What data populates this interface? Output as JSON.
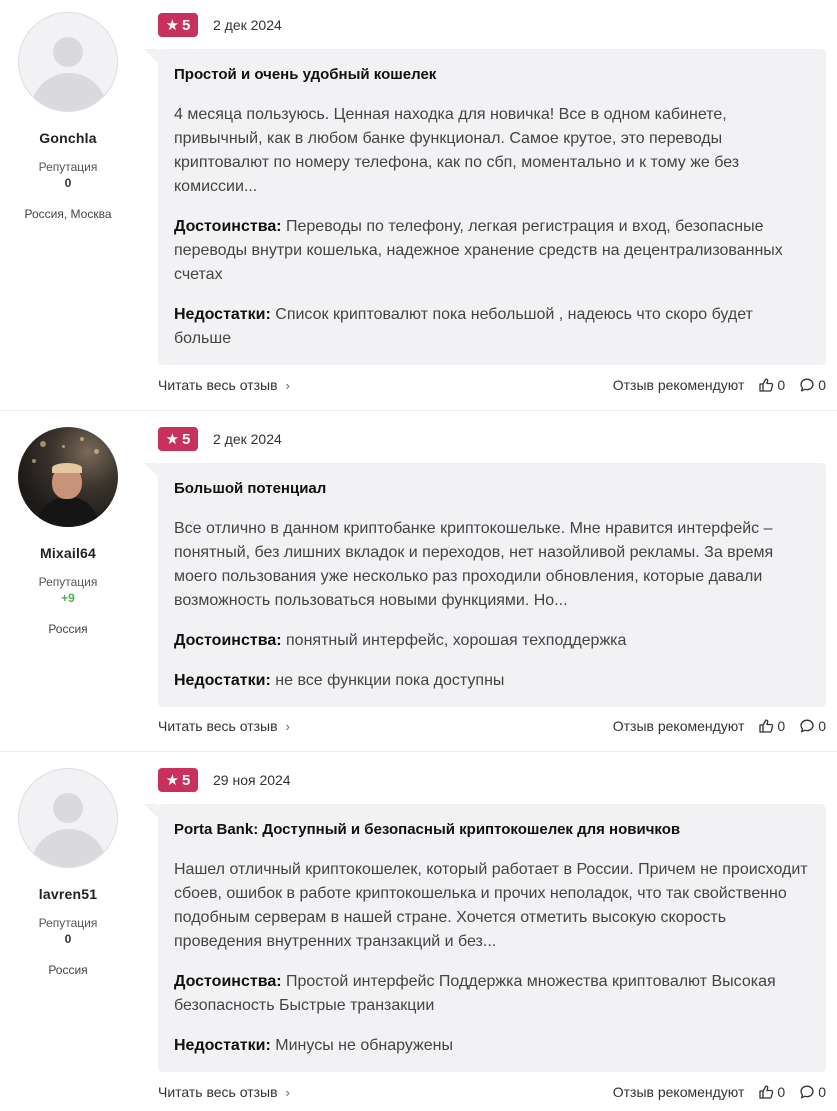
{
  "colors": {
    "rating_badge": "#c8325a",
    "bubble_bg": "#f2f2f4",
    "positive": "#4caf50"
  },
  "labels": {
    "reputation": "Репутация",
    "pros": "Достоинства:",
    "cons": "Недостатки:",
    "read_full": "Читать весь отзыв",
    "recommend": "Отзыв рекомендуют",
    "chevron": "›",
    "star": "★"
  },
  "reviews": [
    {
      "author": {
        "name": "Gonchla",
        "reputation": "0",
        "location": "Россия, Москва",
        "avatar": "placeholder-avatar-icon"
      },
      "rating": "5",
      "date": "2 дек 2024",
      "title": "Простой и очень удобный кошелек",
      "text": "4 месяца пользуюсь. Ценная находка для новичка! Все в одном кабинете, привычный, как в любом банке функционал. Самое крутое, это переводы криптовалют по номеру телефона, как по сбп, моментально и к тому же без комиссии...",
      "pros": "Переводы по телефону, легкая регистрация и вход, безопасные переводы внутри кошелька, надежное хранение средств на децентрализованных счетах",
      "cons": "Список криптовалют пока небольшой , надеюсь что скоро будет больше",
      "likes": "0",
      "comments": "0"
    },
    {
      "author": {
        "name": "Mixail64",
        "reputation": "+9",
        "location": "Россия",
        "avatar": "user-photo"
      },
      "rating": "5",
      "date": "2 дек 2024",
      "title": "Большой потенциал",
      "text": "Все отлично в данном криптобанке криптокошельке. Мне нравится интерфейс – понятный, без лишних вкладок и переходов, нет назойливой рекламы. За время моего пользования уже несколько раз проходили обновления, которые давали возможность пользоваться новыми функциями. Но...",
      "pros": "понятный интерфейс, хорошая техподдержка",
      "cons": "не все функции пока доступны",
      "likes": "0",
      "comments": "0"
    },
    {
      "author": {
        "name": "lavren51",
        "reputation": "0",
        "location": "Россия",
        "avatar": "placeholder-avatar-icon"
      },
      "rating": "5",
      "date": "29 ноя 2024",
      "title": "Porta Bank: Доступный и безопасный криптокошелек для новичков",
      "text": "Нашел отличный криптокошелек, который работает в России. Причем не происходит сбоев, ошибок в работе криптокошелька и прочих неполадок, что так свойственно подобным серверам в нашей стране. Хочется отметить высокую скорость проведения внутренних транзакций и без...",
      "pros": "Простой интерфейс Поддержка множества криптовалют Высокая безопасность Быстрые транзакции",
      "cons": "Минусы не обнаружены",
      "likes": "0",
      "comments": "0"
    }
  ]
}
